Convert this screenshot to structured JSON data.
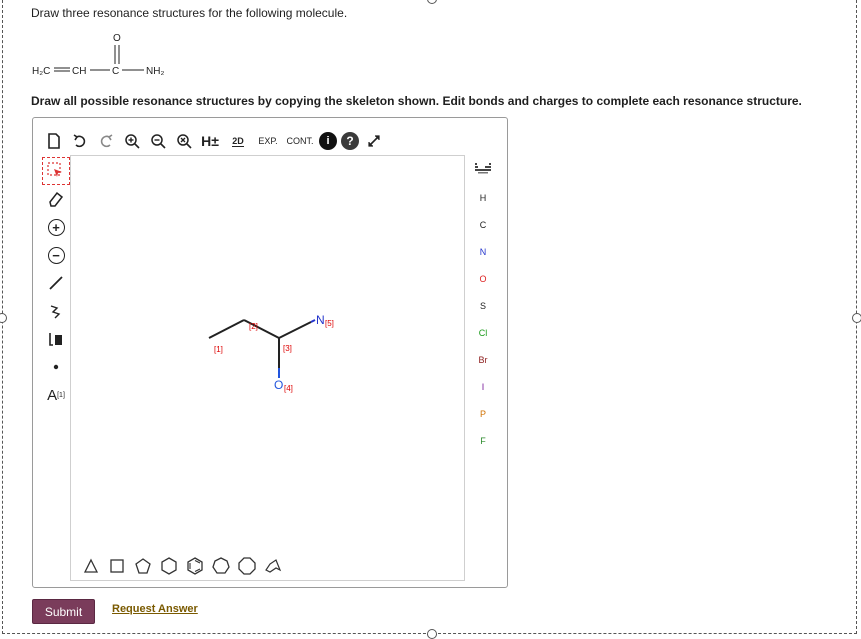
{
  "question": {
    "prompt": "Draw three resonance structures for the following molecule.",
    "instruction": "Draw all possible resonance structures by copying the skeleton shown. Edit bonds and charges to complete each resonance structure."
  },
  "molecule_formula": {
    "o_label": "O",
    "left_group": "H₂C",
    "ch": "CH",
    "c": "C",
    "right_group": "NH₂"
  },
  "editor": {
    "top_toolbar": {
      "h_toggle_label": "H±",
      "twod_label": "2D",
      "exp_label": "EXP.",
      "cont_label": "CONT."
    },
    "left_toolbar": {
      "text_tool_label": "A",
      "text_tool_superscript": "[1]"
    },
    "elements": [
      "H",
      "C",
      "N",
      "O",
      "S",
      "Cl",
      "Br",
      "I",
      "P",
      "F"
    ],
    "element_colors": {
      "H": "#222222",
      "C": "#222222",
      "N": "#2233cc",
      "O": "#dd2222",
      "S": "#222222",
      "Cl": "#1a9a1a",
      "Br": "#8b1a1a",
      "I": "#7a1a9a",
      "P": "#d07000",
      "F": "#2a8a2a"
    },
    "skeleton": {
      "atom_N": "N",
      "atom_O": "O",
      "map_1": "[1]",
      "map_2": "[2]",
      "map_3": "[3]",
      "map_4": "[4]",
      "map_5": "[5]"
    }
  },
  "actions": {
    "submit_label": "Submit",
    "request_answer_label": "Request Answer"
  },
  "colors": {
    "submit_bg": "#7a3c5b",
    "nitrogen": "#2233cc",
    "oxygen": "#2255dd",
    "map_label": "#dd0000"
  }
}
